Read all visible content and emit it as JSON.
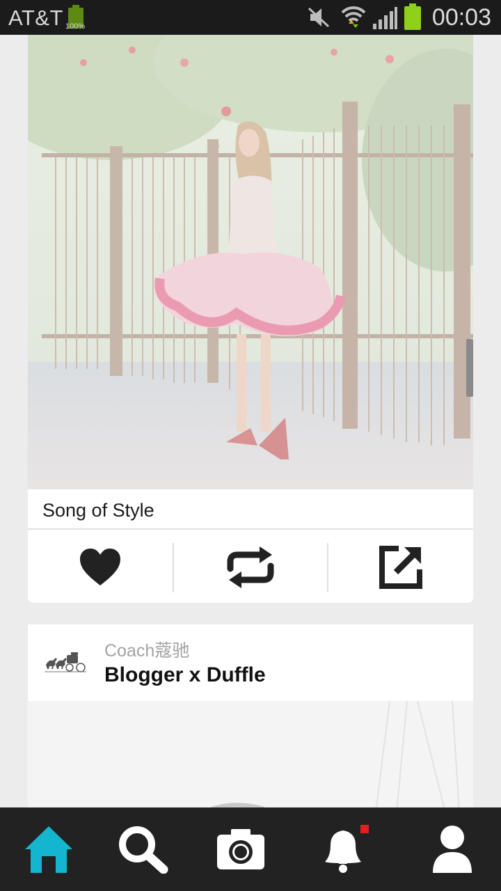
{
  "status_bar": {
    "carrier": "AT&T",
    "battery_small_percent": "100%",
    "time": "00:03",
    "icons": [
      "mute-icon",
      "wifi-icon",
      "signal-icon",
      "battery-icon"
    ],
    "battery_color": "#8fd11a"
  },
  "post1": {
    "caption": "Song of Style",
    "actions": [
      "heart-icon",
      "repost-icon",
      "share-external-icon"
    ]
  },
  "post2": {
    "brand": "Coach蔻驰",
    "title": "Blogger x Duffle"
  },
  "bottom_nav": {
    "items": [
      {
        "icon": "home-icon",
        "active": true
      },
      {
        "icon": "search-icon",
        "active": false
      },
      {
        "icon": "camera-icon",
        "active": false
      },
      {
        "icon": "bell-icon",
        "active": false,
        "badge": true
      },
      {
        "icon": "profile-icon",
        "active": false
      }
    ],
    "active_color": "#13b5cf",
    "badge_color": "#e02020"
  }
}
